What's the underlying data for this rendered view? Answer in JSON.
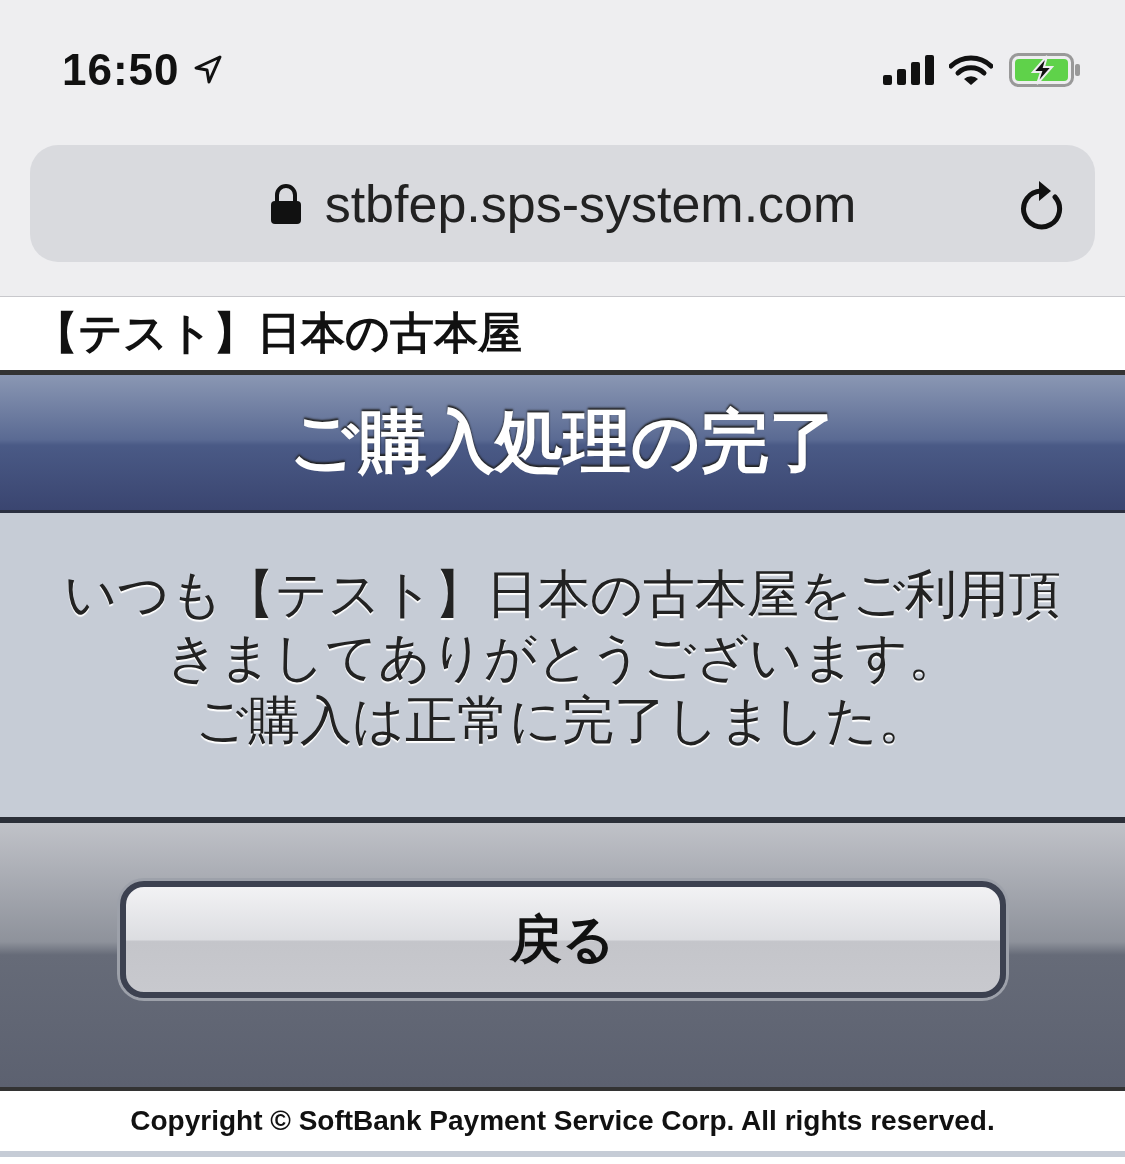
{
  "status_bar": {
    "time": "16:50"
  },
  "address_bar": {
    "url": "stbfep.sps-system.com",
    "secure": true
  },
  "shop_name": "【テスト】日本の古本屋",
  "header": {
    "title": "ご購入処理の完了"
  },
  "message_lines": [
    "いつも【テスト】日本の古本屋をご利用頂",
    "きましてありがとうございます。",
    "ご購入は正常に完了しました。"
  ],
  "back_button": {
    "label": "戻る"
  },
  "footer": {
    "copyright": "Copyright © SoftBank Payment Service Corp. All rights reserved."
  }
}
